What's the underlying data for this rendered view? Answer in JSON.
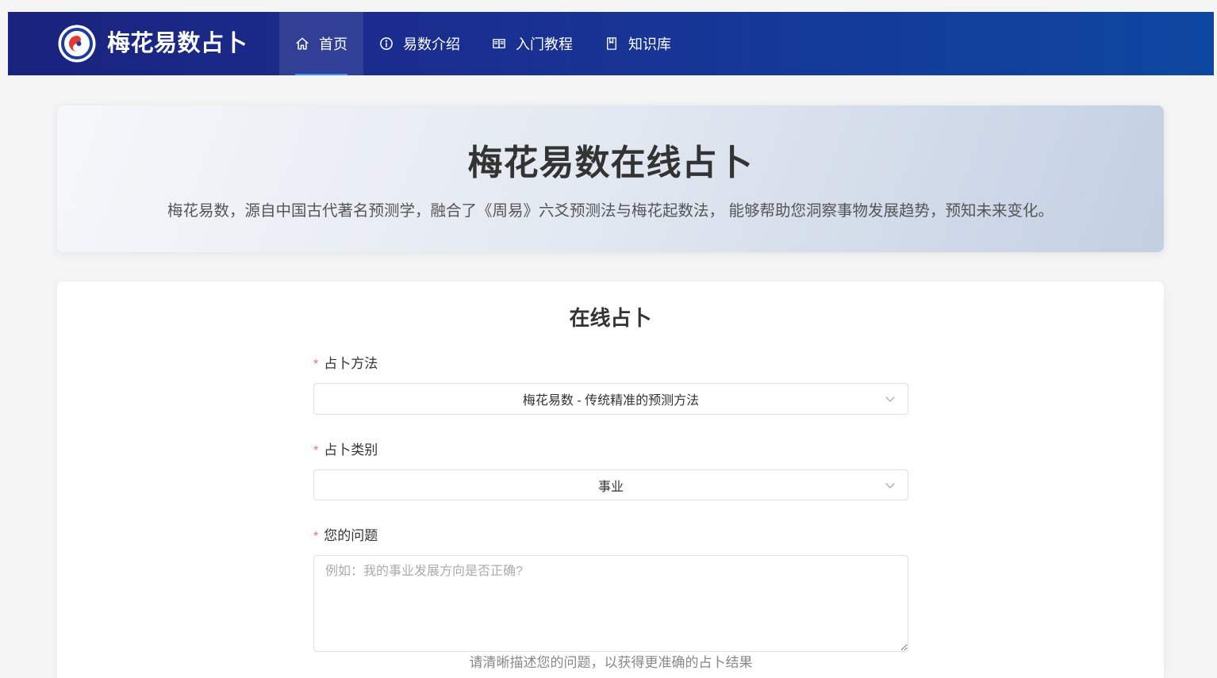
{
  "header": {
    "logo_text": "梅花易数占卜",
    "nav": [
      {
        "label": "首页",
        "icon": "home-icon",
        "active": true
      },
      {
        "label": "易数介绍",
        "icon": "info-icon",
        "active": false
      },
      {
        "label": "入门教程",
        "icon": "book-open-icon",
        "active": false
      },
      {
        "label": "知识库",
        "icon": "book-icon",
        "active": false
      }
    ]
  },
  "hero": {
    "title": "梅花易数在线占卜",
    "description": "梅花易数，源自中国古代著名预测学，融合了《周易》六爻预测法与梅花起数法， 能够帮助您洞察事物发展趋势，预知未来变化。"
  },
  "form": {
    "title": "在线占卜",
    "required_mark": "*",
    "method": {
      "label": "占卜方法",
      "value": "梅花易数 - 传统精准的预测方法"
    },
    "category": {
      "label": "占卜类别",
      "value": "事业"
    },
    "question": {
      "label": "您的问题",
      "placeholder": "例如：我的事业发展方向是否正确?",
      "hint": "请清晰描述您的问题，以获得更准确的占卜结果"
    }
  },
  "colors": {
    "header_start": "#1a237e",
    "header_end": "#0d47a1",
    "accent": "#3d8bff",
    "required": "#f56c6c"
  }
}
